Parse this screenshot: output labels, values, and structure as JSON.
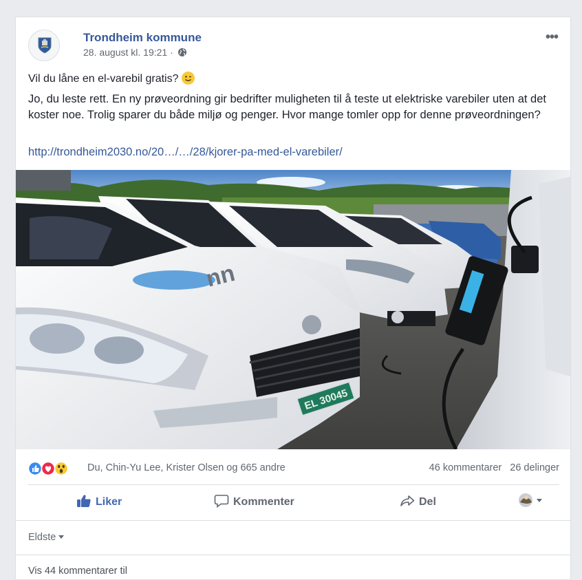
{
  "post": {
    "author": "Trondheim kommune",
    "timestamp": "28. august kl. 19:21 ·",
    "audience_icon": "globe-icon",
    "more_label": "•••",
    "line1": "Vil du låne en el-varebil gratis?",
    "line1_emoji": "wink-emoji",
    "body": "Jo, du leste rett. En ny prøveordning gir bedrifter muligheten til å teste ut elektriske varebiler uten at det koster noe. Trolig sparer du både miljø og penger. Hvor mange tomler opp for denne prøveordningen?",
    "link": "http://trondheim2030.no/20…/…/28/kjorer-pa-med-el-varebiler/",
    "image": {
      "description_icon": "electric-vans-photo",
      "plate_text": "EL 30045"
    }
  },
  "reactions": {
    "icons": [
      "like-icon",
      "love-icon",
      "wow-icon"
    ],
    "names": "Du, Chin-Yu Lee, Krister Olsen og 665 andre",
    "comments": "46 kommentarer",
    "shares": "26 delinger"
  },
  "actions": {
    "like": "Liker",
    "comment": "Kommenter",
    "share": "Del"
  },
  "comments": {
    "sort": "Eldste",
    "view_more": "Vis 44 kommentarer til"
  },
  "colors": {
    "link_blue": "#365899",
    "like_blue": "#4267b2",
    "muted": "#606770"
  }
}
